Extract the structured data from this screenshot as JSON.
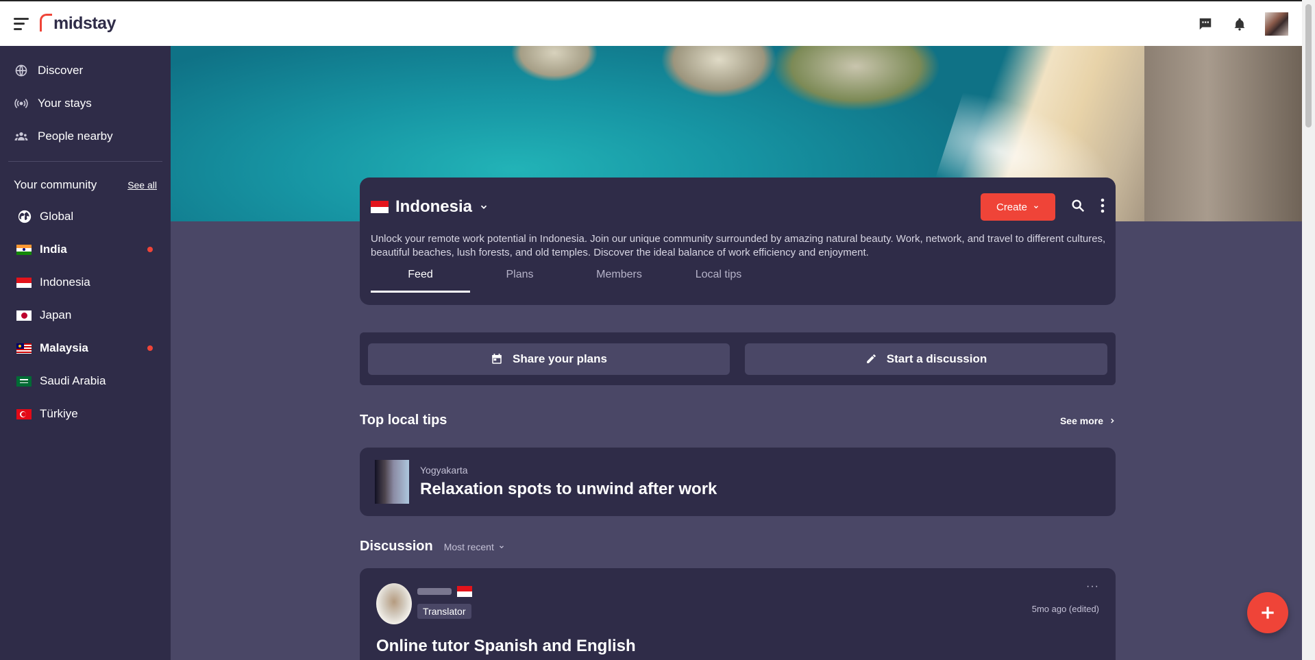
{
  "header": {
    "logo": "midstay"
  },
  "sidebar": {
    "nav": [
      {
        "label": "Discover",
        "icon": "globe-icon"
      },
      {
        "label": "Your stays",
        "icon": "broadcast-icon"
      },
      {
        "label": "People nearby",
        "icon": "people-icon"
      }
    ],
    "community_title": "Your community",
    "see_all": "See all",
    "communities": [
      {
        "label": "Global",
        "bold": false,
        "unread": false
      },
      {
        "label": "India",
        "bold": true,
        "unread": true
      },
      {
        "label": "Indonesia",
        "bold": false,
        "unread": false
      },
      {
        "label": "Japan",
        "bold": false,
        "unread": false
      },
      {
        "label": "Malaysia",
        "bold": true,
        "unread": true
      },
      {
        "label": "Saudi Arabia",
        "bold": false,
        "unread": false
      },
      {
        "label": "Türkiye",
        "bold": false,
        "unread": false
      }
    ]
  },
  "community": {
    "name": "Indonesia",
    "create_label": "Create",
    "description": "Unlock your remote work potential in Indonesia. Join our unique community surrounded by amazing natural beauty. Work, network, and travel to different cultures, beautiful beaches, lush forests, and old temples. Discover the ideal balance of work efficiency and enjoyment.",
    "tabs": [
      "Feed",
      "Plans",
      "Members",
      "Local tips"
    ],
    "active_tab": "Feed"
  },
  "actions": {
    "share_plans": "Share your plans",
    "start_discussion": "Start a discussion"
  },
  "tips": {
    "title": "Top local tips",
    "see_more": "See more",
    "card": {
      "city": "Yogyakarta",
      "title": "Relaxation spots to unwind after work"
    }
  },
  "discussion": {
    "title": "Discussion",
    "sort": "Most recent",
    "post": {
      "badge": "Translator",
      "more": "···",
      "time": "5mo ago (edited)",
      "title": "Online tutor Spanish and English"
    }
  },
  "colors": {
    "accent": "#ef4438",
    "sidebar": "#2f2c48",
    "background": "#4a4766"
  }
}
